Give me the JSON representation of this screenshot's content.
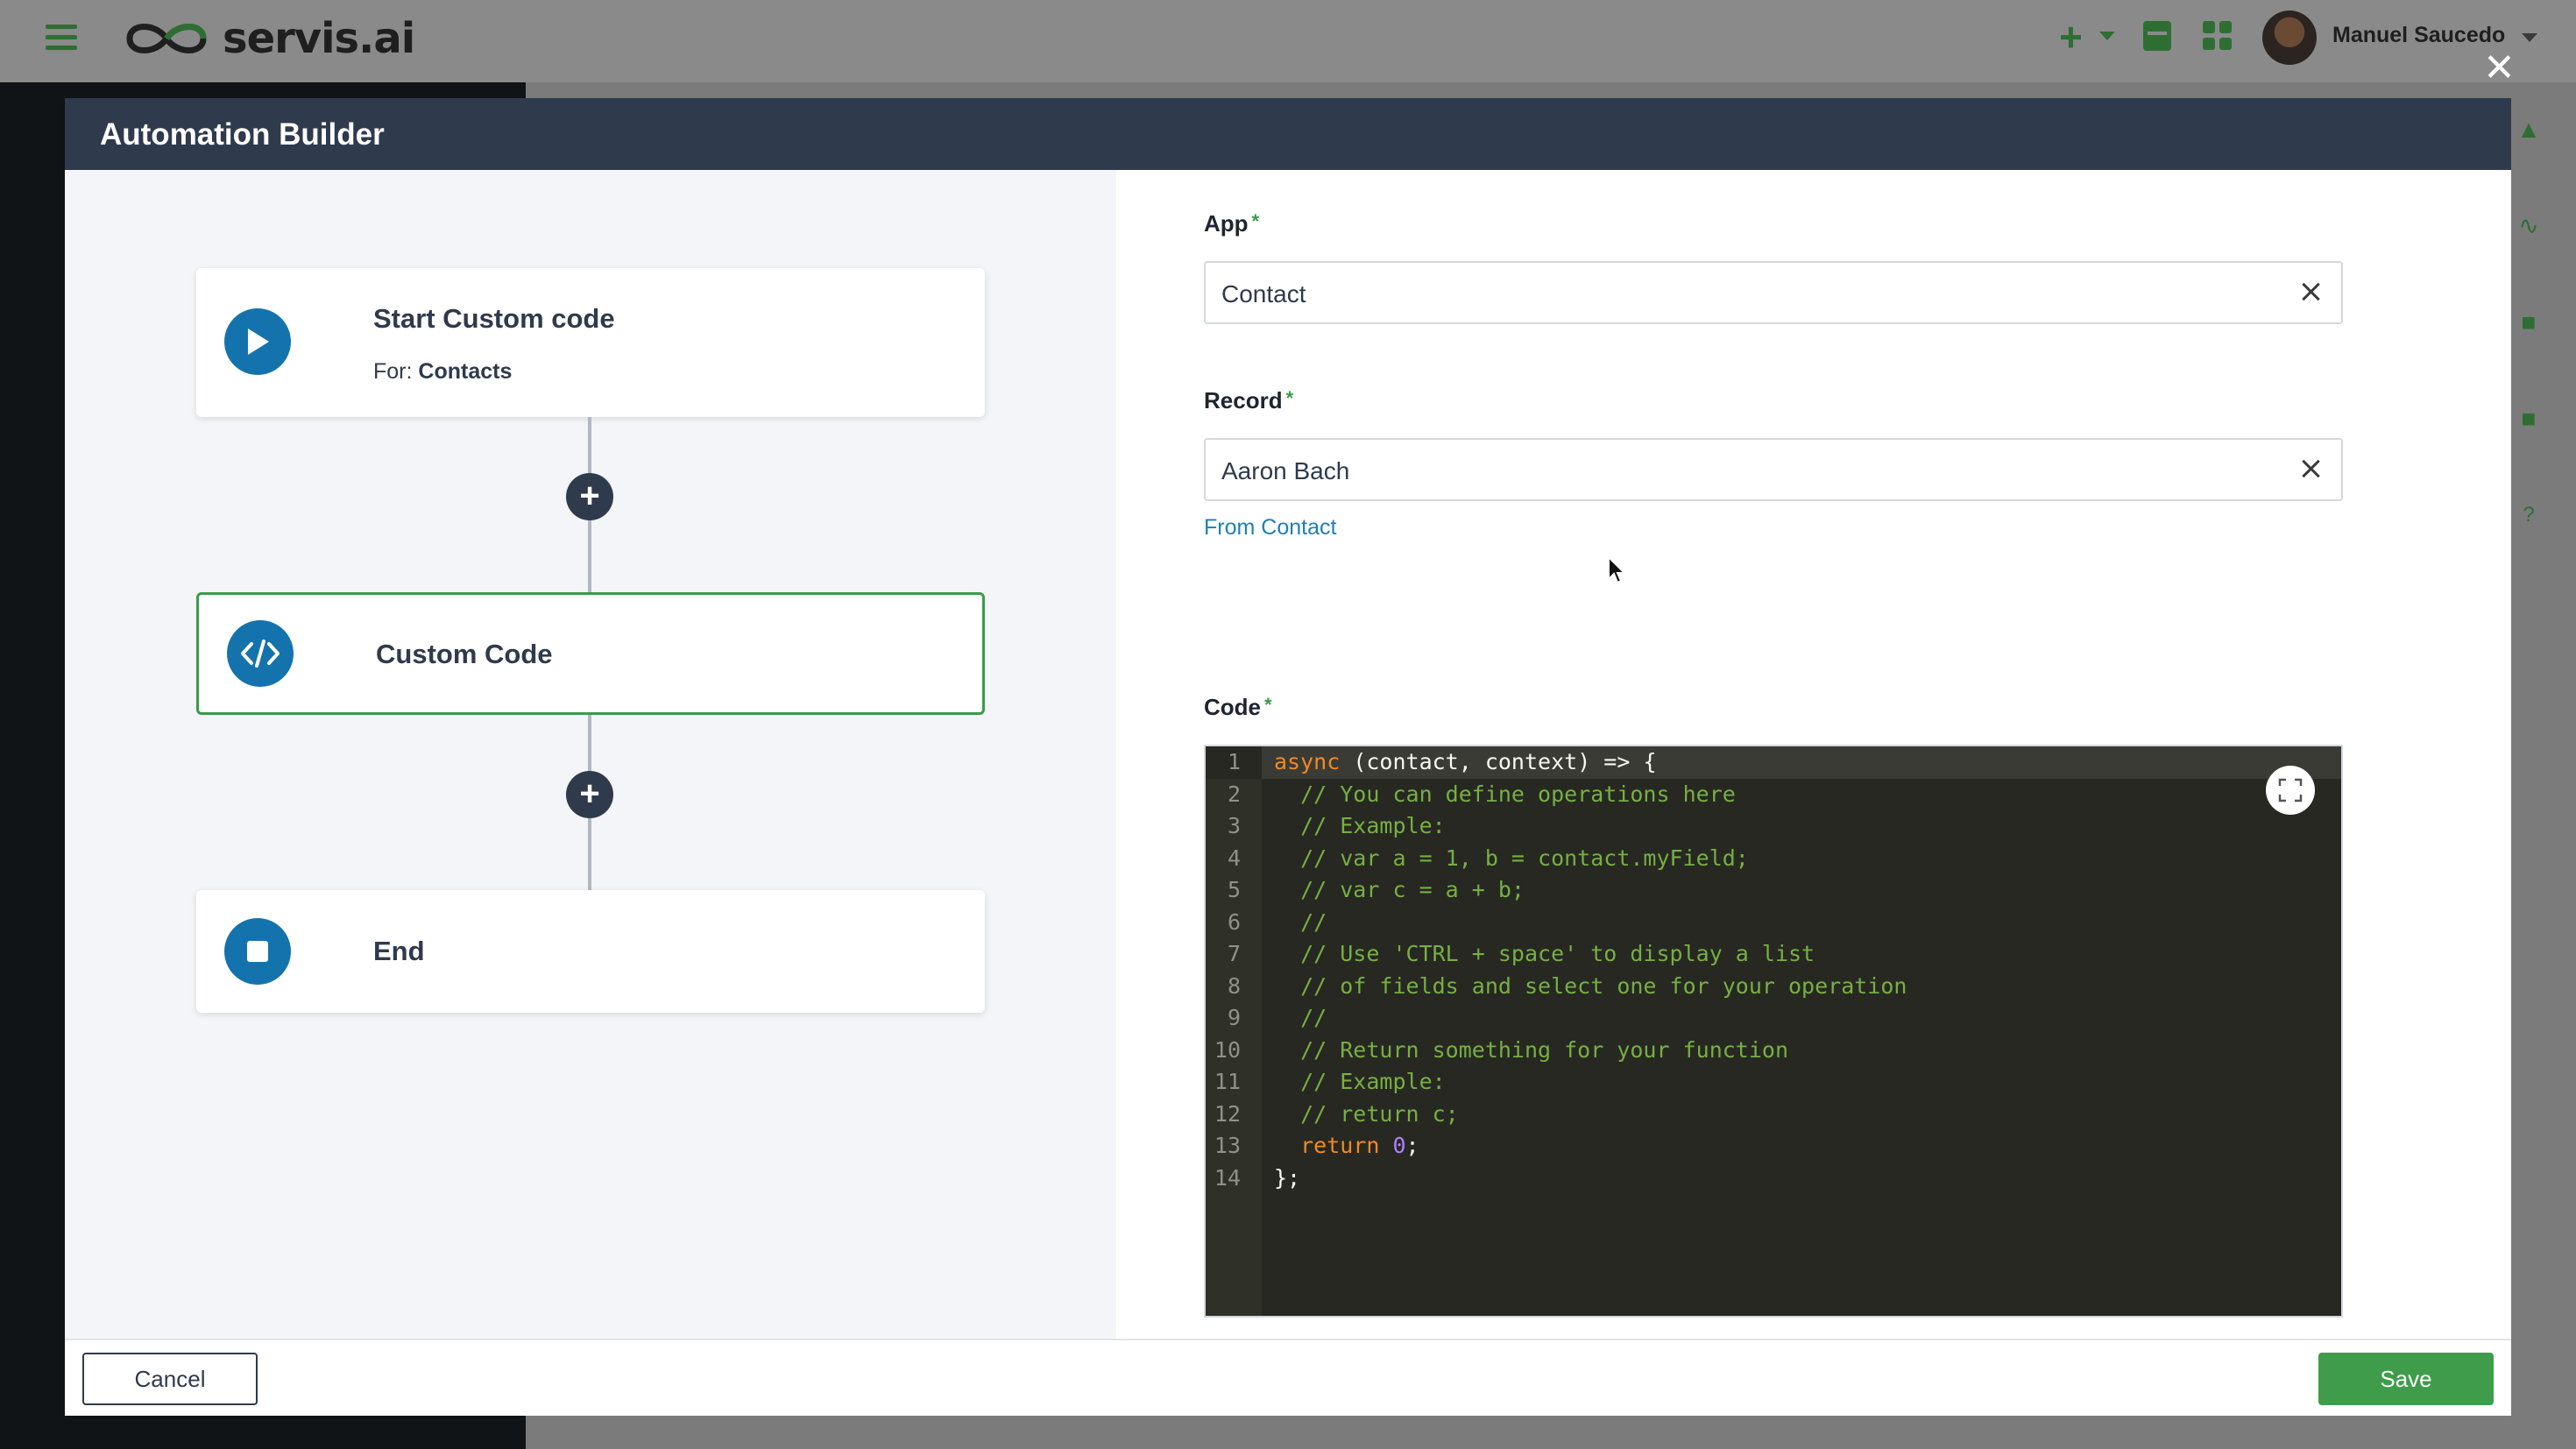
{
  "app": {
    "brand": "servis.ai",
    "user_name": "Manuel Saucedo",
    "brand_color": "#3e9c4a"
  },
  "modal": {
    "title": "Automation Builder",
    "close_icon": "close-icon"
  },
  "workflow": {
    "start": {
      "title": "Start Custom code",
      "for_label": "For:",
      "for_value": "Contacts",
      "icon": "play-icon"
    },
    "step": {
      "title": "Custom Code",
      "icon": "code-icon"
    },
    "end": {
      "title": "End",
      "icon": "stop-icon"
    },
    "add_label": "+"
  },
  "form": {
    "app": {
      "label": "App",
      "value": "Contact"
    },
    "record": {
      "label": "Record",
      "value": "Aaron Bach",
      "link": "From Contact"
    },
    "code": {
      "label": "Code",
      "gutter": [
        "1",
        "2",
        "3",
        "4",
        "5",
        "6",
        "7",
        "8",
        "9",
        "10",
        "11",
        "12",
        "13",
        "14"
      ],
      "lines": [
        {
          "kw": "async",
          "text": " (contact, context) => {"
        },
        {
          "cm": "  // You can define operations here"
        },
        {
          "cm": "  // Example:"
        },
        {
          "cm": "  // var a = 1, b = contact.myField;"
        },
        {
          "cm": "  // var c = a + b;"
        },
        {
          "cm": "  //"
        },
        {
          "cm": "  // Use 'CTRL + space' to display a list"
        },
        {
          "cm": "  // of fields and select one for your operation"
        },
        {
          "cm": "  //"
        },
        {
          "cm": "  // Return something for your function"
        },
        {
          "cm": "  // Example:"
        },
        {
          "cm": "  // return c;"
        },
        {
          "pre": "  ",
          "kw": "return",
          "num": " 0",
          "text": ";"
        },
        {
          "text": "};"
        }
      ]
    }
  },
  "footer": {
    "cancel_label": "Cancel",
    "save_label": "Save"
  }
}
